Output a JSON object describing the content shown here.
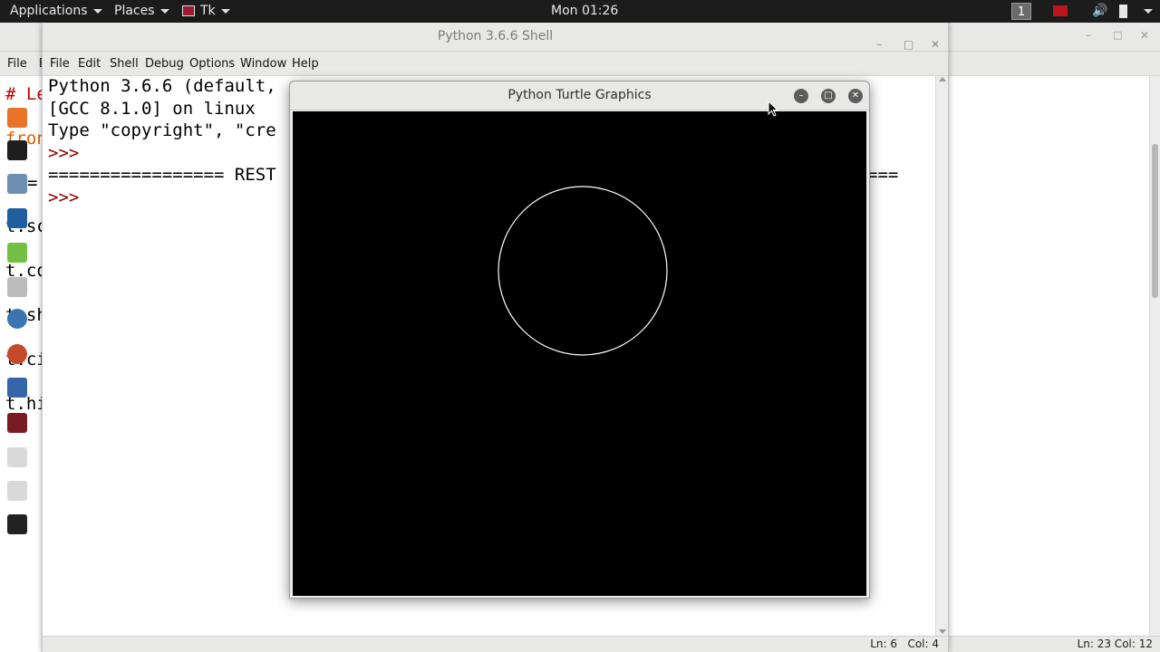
{
  "topbar": {
    "applications": "Applications",
    "places": "Places",
    "tk_app": "Tk",
    "clock": "Mon 01:26",
    "workspace": "1"
  },
  "shell": {
    "title": "Python 3.6.6 Shell",
    "menu": [
      "File",
      "Edit",
      "Shell",
      "Debug",
      "Options",
      "Window",
      "Help"
    ],
    "lines": [
      "Python 3.6.6 (default,",
      "[GCC 8.1.0] on linux",
      "Type \"copyright\", \"cre",
      ">>>",
      "================= REST",
      ">>>"
    ],
    "rule_tail": "===",
    "status": "Ln: 6   Col: 4"
  },
  "left_editor": {
    "menu_file": "File",
    "menu_e": "E",
    "code": [
      "# Le",
      "fron",
      "=",
      "t.sc",
      "t.co",
      "t.sh",
      "t.ci",
      "t.hi"
    ]
  },
  "right_editor": {
    "status": "Ln: 23   Col: 12"
  },
  "turtle": {
    "title": "Python Turtle Graphics",
    "background": "#000000",
    "stroke": "#ffffff"
  }
}
